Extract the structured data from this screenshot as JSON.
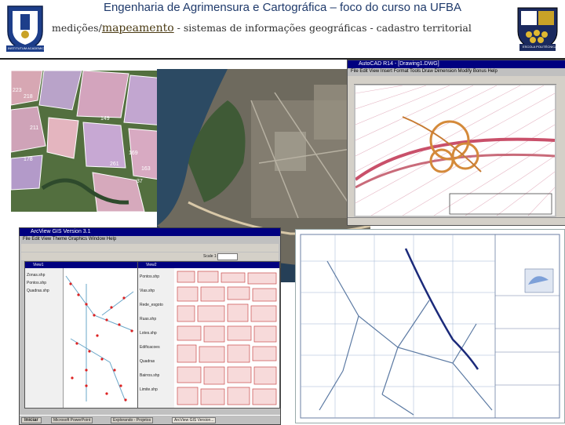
{
  "header": {
    "title": "Engenharia de Agrimensura e Cartográfica – foco do curso na UFBA",
    "subtitle_prefix": "medições/",
    "subtitle_emph": "mapeamento",
    "subtitle_rest": " -  sistemas de informações geográficas  -  cadastro territorial"
  },
  "logos": {
    "left_ribbon": "INSTITUTUM ACADEMICUM",
    "right_ribbon": "ESCOLA POLITÉCNICA"
  },
  "cad_window": {
    "title": "AutoCAD R14 - [Drawing1.DWG]",
    "menu": "File  Edit  View  Insert  Format  Tools  Draw  Dimension  Modify  Bonus  Help"
  },
  "arcview": {
    "title": "ArcView GIS Version 3.1",
    "menu": "File  Edit  View  Theme  Graphics  Window  Help",
    "scale_label": "Scale 1:",
    "view1_title": "View1",
    "view2_title": "View2",
    "layers_left": [
      "Zonas.shp",
      "Pontos.shp",
      "Quadras.shp"
    ],
    "layers_right": [
      "Pontos.shp",
      "Vias.shp",
      "Rede_esgoto",
      "Ruas.shp",
      "Lotes.shp",
      "Edificacoes",
      "Quadras",
      "Bairros.shp",
      "Limite.shp"
    ]
  },
  "taskbar": {
    "start": "Iniciar",
    "items": [
      "Microsoft PowerPoint",
      "Explorando - Projetos",
      "ArcView GIS Version..."
    ]
  },
  "map_labels": [
    "223",
    "218",
    "211",
    "149",
    "178",
    "261",
    "169",
    "37",
    "163"
  ],
  "colors": {
    "accent": "#1f3a6b",
    "win_title": "#000080",
    "win_face": "#c0c0c0",
    "desktop": "#008080"
  }
}
